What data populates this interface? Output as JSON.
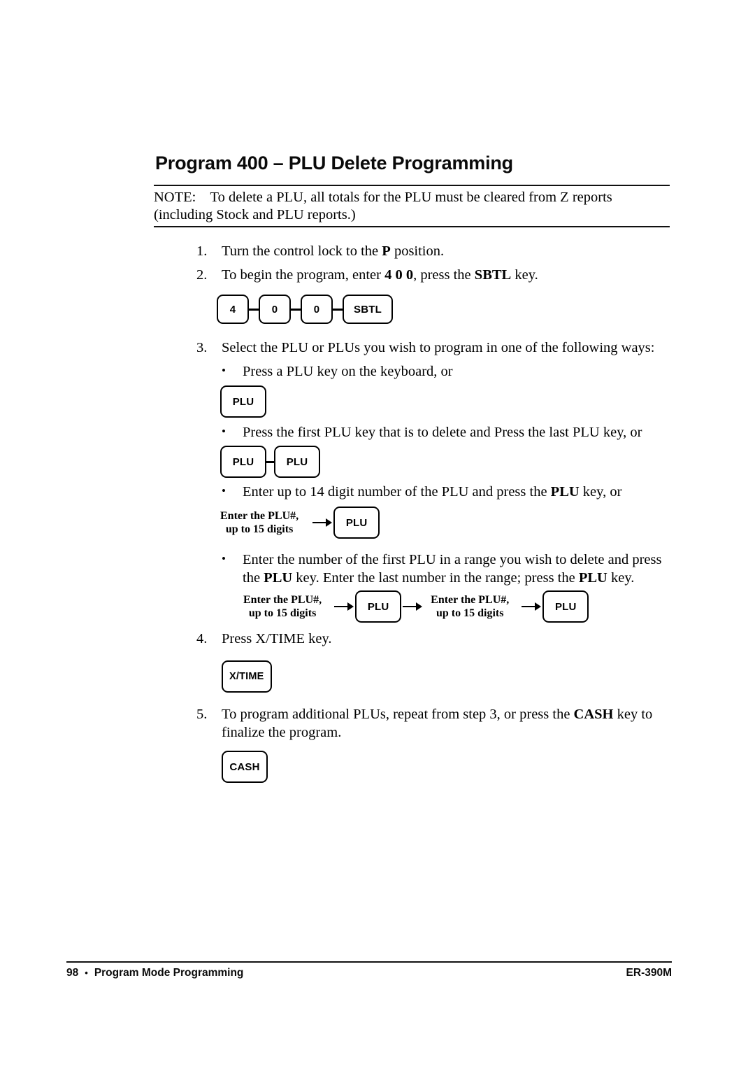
{
  "document": {
    "title": "Program 400 – PLU Delete Programming",
    "note": {
      "label": "NOTE:",
      "text": "To delete a PLU, all totals for the PLU must be cleared from Z reports (including Stock and PLU reports.)"
    },
    "steps": [
      {
        "number": "1.",
        "text_parts": [
          "Turn the control lock to the ",
          "P",
          " position."
        ]
      },
      {
        "number": "2.",
        "text_parts": [
          "To begin the program, enter ",
          "4 0 0",
          ", press the ",
          "SBTL",
          " key."
        ]
      },
      {
        "number": "3.",
        "text": "Select the PLU or PLUs you wish to program in one of the following ways:"
      },
      {
        "number": "4.",
        "text": "Press X/TIME key."
      },
      {
        "number": "5.",
        "text_parts": [
          "To program additional PLUs, repeat from step 3, or press the ",
          "CASH",
          " key to finalize the program."
        ]
      }
    ],
    "bullets": [
      {
        "marker": "•",
        "text": "Press a PLU key on the keyboard, or"
      },
      {
        "marker": "•",
        "text": "Press the first PLU key that is to delete and Press the last PLU key, or"
      },
      {
        "marker": "•",
        "text_parts": [
          "Enter up to 14 digit number of the PLU and press the ",
          "PLU",
          " key, or"
        ]
      },
      {
        "marker": "•",
        "text_parts": [
          "Enter the number of the first PLU in a range you wish to delete and press the ",
          "PLU",
          " key.    Enter the last number in the range; press the ",
          "PLU",
          " key."
        ]
      }
    ],
    "key_diagrams": {
      "program_code": {
        "keys": [
          "4",
          "0",
          "0",
          "SBTL"
        ]
      },
      "single_plu": {
        "keys": [
          "PLU"
        ]
      },
      "plu_pair": {
        "keys": [
          "PLU",
          "PLU"
        ]
      },
      "plu_number": {
        "label_line1": "Enter the PLU#,",
        "label_line2": "up to 15 digits",
        "key": "PLU"
      },
      "plu_range": {
        "first_label_line1": "Enter the PLU#,",
        "first_label_line2": "up to 15 digits",
        "first_key": "PLU",
        "second_label_line1": "Enter the PLU#,",
        "second_label_line2": "up to 15 digits",
        "second_key": "PLU"
      },
      "xtime": {
        "key": "X/TIME"
      },
      "cash": {
        "key": "CASH"
      }
    }
  },
  "footer": {
    "page_number": "98",
    "separator": "•",
    "section": "Program Mode Programming",
    "model": "ER-390M"
  },
  "colors": {
    "text": "#000000",
    "rule": "#111111",
    "background": "#ffffff"
  }
}
